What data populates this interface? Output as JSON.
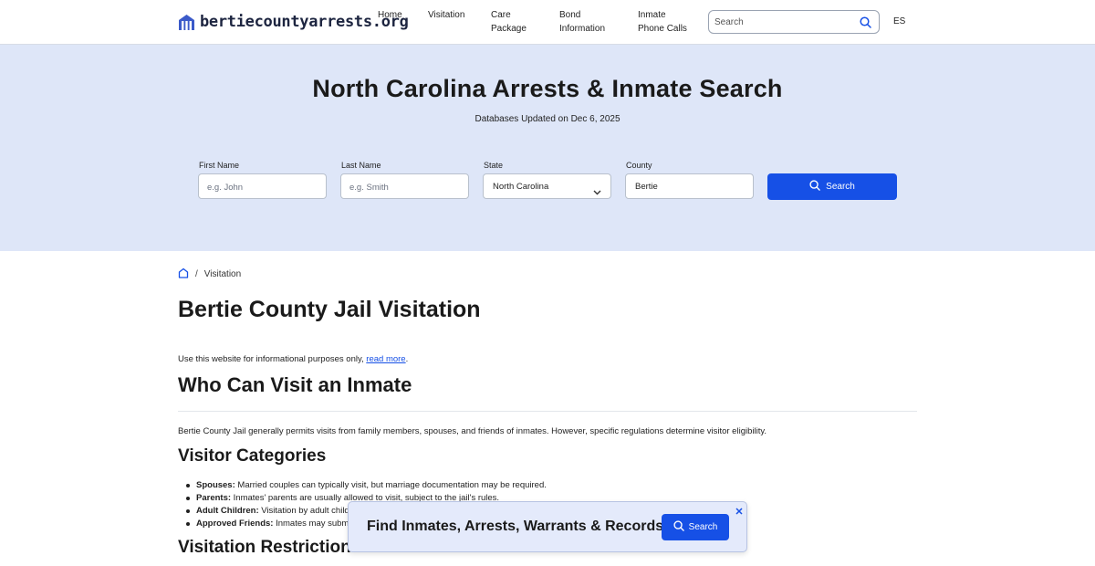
{
  "header": {
    "site_name": "bertiecountyarrests.org",
    "nav": [
      {
        "label": "Home"
      },
      {
        "label": "Visitation"
      },
      {
        "label": "Care Package"
      },
      {
        "label": "Bond Information"
      },
      {
        "label": "Inmate Phone Calls"
      }
    ],
    "search_placeholder": "Search",
    "language": "ES"
  },
  "hero": {
    "title": "North Carolina Arrests & Inmate Search",
    "subtitle": "Databases Updated on Dec 6, 2025",
    "first_name": {
      "label": "First Name",
      "placeholder": "e.g. John"
    },
    "last_name": {
      "label": "Last Name",
      "placeholder": "e.g. Smith"
    },
    "state": {
      "label": "State",
      "value": "North Carolina"
    },
    "county": {
      "label": "County",
      "value": "Bertie"
    },
    "search_button": "Search"
  },
  "breadcrumb": {
    "current": "Visitation",
    "separator": "/"
  },
  "main": {
    "title": "Bertie County Jail Visitation",
    "disclaimer_prefix": "Use this website for informational purposes only, ",
    "disclaimer_link": "read more",
    "disclaimer_suffix": ".",
    "section1_title": "Who Can Visit an Inmate",
    "section1_text": "Bertie County Jail generally permits visits from family members, spouses, and friends of inmates. However, specific regulations determine visitor eligibility.",
    "section2_title": "Visitor Categories",
    "visitor_categories": [
      {
        "term": "Spouses:",
        "text": " Married couples can typically visit, but marriage documentation may be required."
      },
      {
        "term": "Parents:",
        "text": " Inmates' parents are usually allowed to visit, subject to the jail's rules."
      },
      {
        "term": "Adult Children:",
        "text": " Visitation by adult child"
      },
      {
        "term": "Approved Friends:",
        "text": " Inmates may submit"
      }
    ],
    "section3_title": "Visitation Restrictions"
  },
  "popup": {
    "text": "Find Inmates, Arrests, Warrants & Records",
    "button": "Search"
  },
  "colors": {
    "accent": "#1650e6",
    "hero_bg": "#dee6f8",
    "popup_bg": "#e4eafb"
  }
}
